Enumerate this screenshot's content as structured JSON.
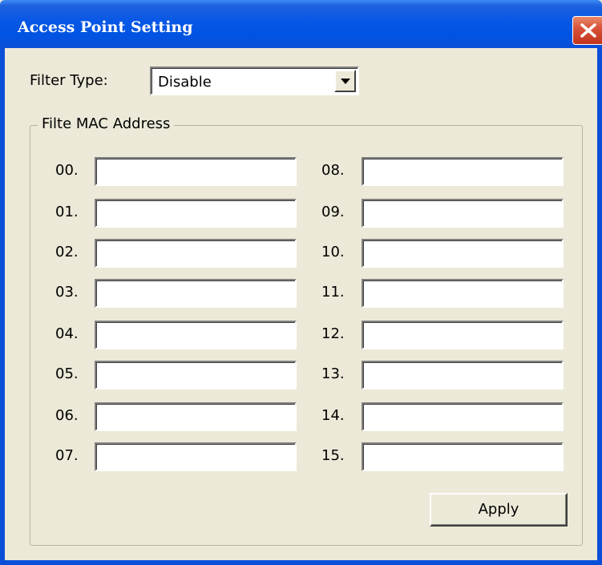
{
  "window": {
    "title": "Access Point Setting",
    "close_icon": "close-icon"
  },
  "filter": {
    "label": "Filter Type:",
    "selected": "Disable",
    "dropdown_icon": "chevron-down-icon"
  },
  "mac_group": {
    "legend": "Filte MAC Address",
    "left_column": [
      {
        "index": "00.",
        "value": ""
      },
      {
        "index": "01.",
        "value": ""
      },
      {
        "index": "02.",
        "value": ""
      },
      {
        "index": "03.",
        "value": ""
      },
      {
        "index": "04.",
        "value": ""
      },
      {
        "index": "05.",
        "value": ""
      },
      {
        "index": "06.",
        "value": ""
      },
      {
        "index": "07.",
        "value": ""
      }
    ],
    "right_column": [
      {
        "index": "08.",
        "value": ""
      },
      {
        "index": "09.",
        "value": ""
      },
      {
        "index": "10.",
        "value": ""
      },
      {
        "index": "11.",
        "value": ""
      },
      {
        "index": "12.",
        "value": ""
      },
      {
        "index": "13.",
        "value": ""
      },
      {
        "index": "14.",
        "value": ""
      },
      {
        "index": "15.",
        "value": ""
      }
    ]
  },
  "actions": {
    "apply_label": "Apply"
  },
  "colors": {
    "titlebar": "#0054e3",
    "window_bg": "#ece9d8",
    "close_button": "#d9533a"
  }
}
